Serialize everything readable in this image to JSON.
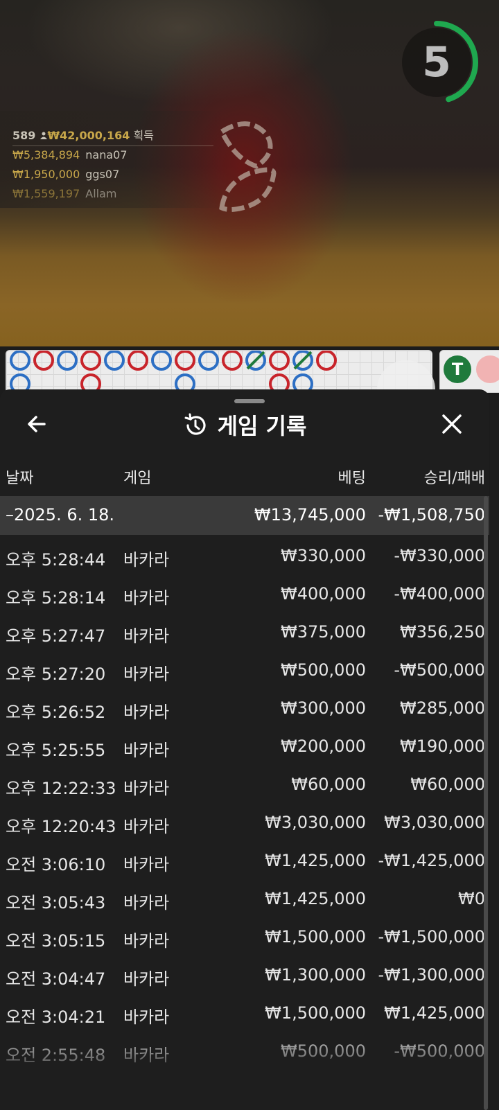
{
  "video": {
    "countdown": "5",
    "countdown_progress": 0.45,
    "winners": {
      "count": "589",
      "total": "₩42,000,164",
      "suffix": "획득",
      "list": [
        {
          "amount": "₩5,384,894",
          "name": "nana07"
        },
        {
          "amount": "₩1,950,000",
          "name": "ggs07"
        },
        {
          "amount": "₩1,559,197",
          "name": "Allam"
        }
      ]
    }
  },
  "roadmap": {
    "colors": {
      "banker": "#c8242b",
      "player": "#2d6fc4",
      "tie": "#1f7a3c"
    },
    "top_row": [
      "P",
      "B",
      "P",
      "B",
      "P",
      "B",
      "P",
      "B",
      "P",
      "B",
      "P",
      "B",
      "P",
      "B"
    ],
    "tie_badge": "T"
  },
  "sheet": {
    "title": "게임 기록",
    "title_icon": "history-icon",
    "back_icon": "arrow-left-icon",
    "close_icon": "close-icon",
    "columns": {
      "date": "날짜",
      "game": "게임",
      "bet": "베팅",
      "result": "승리/패배"
    },
    "date_group": {
      "date": "2025. 6. 18.",
      "bet": "₩13,745,000",
      "result": "-₩1,508,750"
    },
    "rows": [
      {
        "time": "오후 5:28:44",
        "game": "바카라",
        "bet": "₩330,000",
        "result": "-₩330,000"
      },
      {
        "time": "오후 5:28:14",
        "game": "바카라",
        "bet": "₩400,000",
        "result": "-₩400,000"
      },
      {
        "time": "오후 5:27:47",
        "game": "바카라",
        "bet": "₩375,000",
        "result": "₩356,250"
      },
      {
        "time": "오후 5:27:20",
        "game": "바카라",
        "bet": "₩500,000",
        "result": "-₩500,000"
      },
      {
        "time": "오후 5:26:52",
        "game": "바카라",
        "bet": "₩300,000",
        "result": "₩285,000"
      },
      {
        "time": "오후 5:25:55",
        "game": "바카라",
        "bet": "₩200,000",
        "result": "₩190,000"
      },
      {
        "time": "오후 12:22:33",
        "game": "바카라",
        "bet": "₩60,000",
        "result": "₩60,000"
      },
      {
        "time": "오후 12:20:43",
        "game": "바카라",
        "bet": "₩3,030,000",
        "result": "₩3,030,000"
      },
      {
        "time": "오전 3:06:10",
        "game": "바카라",
        "bet": "₩1,425,000",
        "result": "-₩1,425,000"
      },
      {
        "time": "오전 3:05:43",
        "game": "바카라",
        "bet": "₩1,425,000",
        "result": "₩0"
      },
      {
        "time": "오전 3:05:15",
        "game": "바카라",
        "bet": "₩1,500,000",
        "result": "-₩1,500,000"
      },
      {
        "time": "오전 3:04:47",
        "game": "바카라",
        "bet": "₩1,300,000",
        "result": "-₩1,300,000"
      },
      {
        "time": "오전 3:04:21",
        "game": "바카라",
        "bet": "₩1,500,000",
        "result": "₩1,425,000"
      },
      {
        "time": "오전 2:55:48",
        "game": "바카라",
        "bet": "₩500,000",
        "result": "-₩500,000"
      }
    ]
  }
}
